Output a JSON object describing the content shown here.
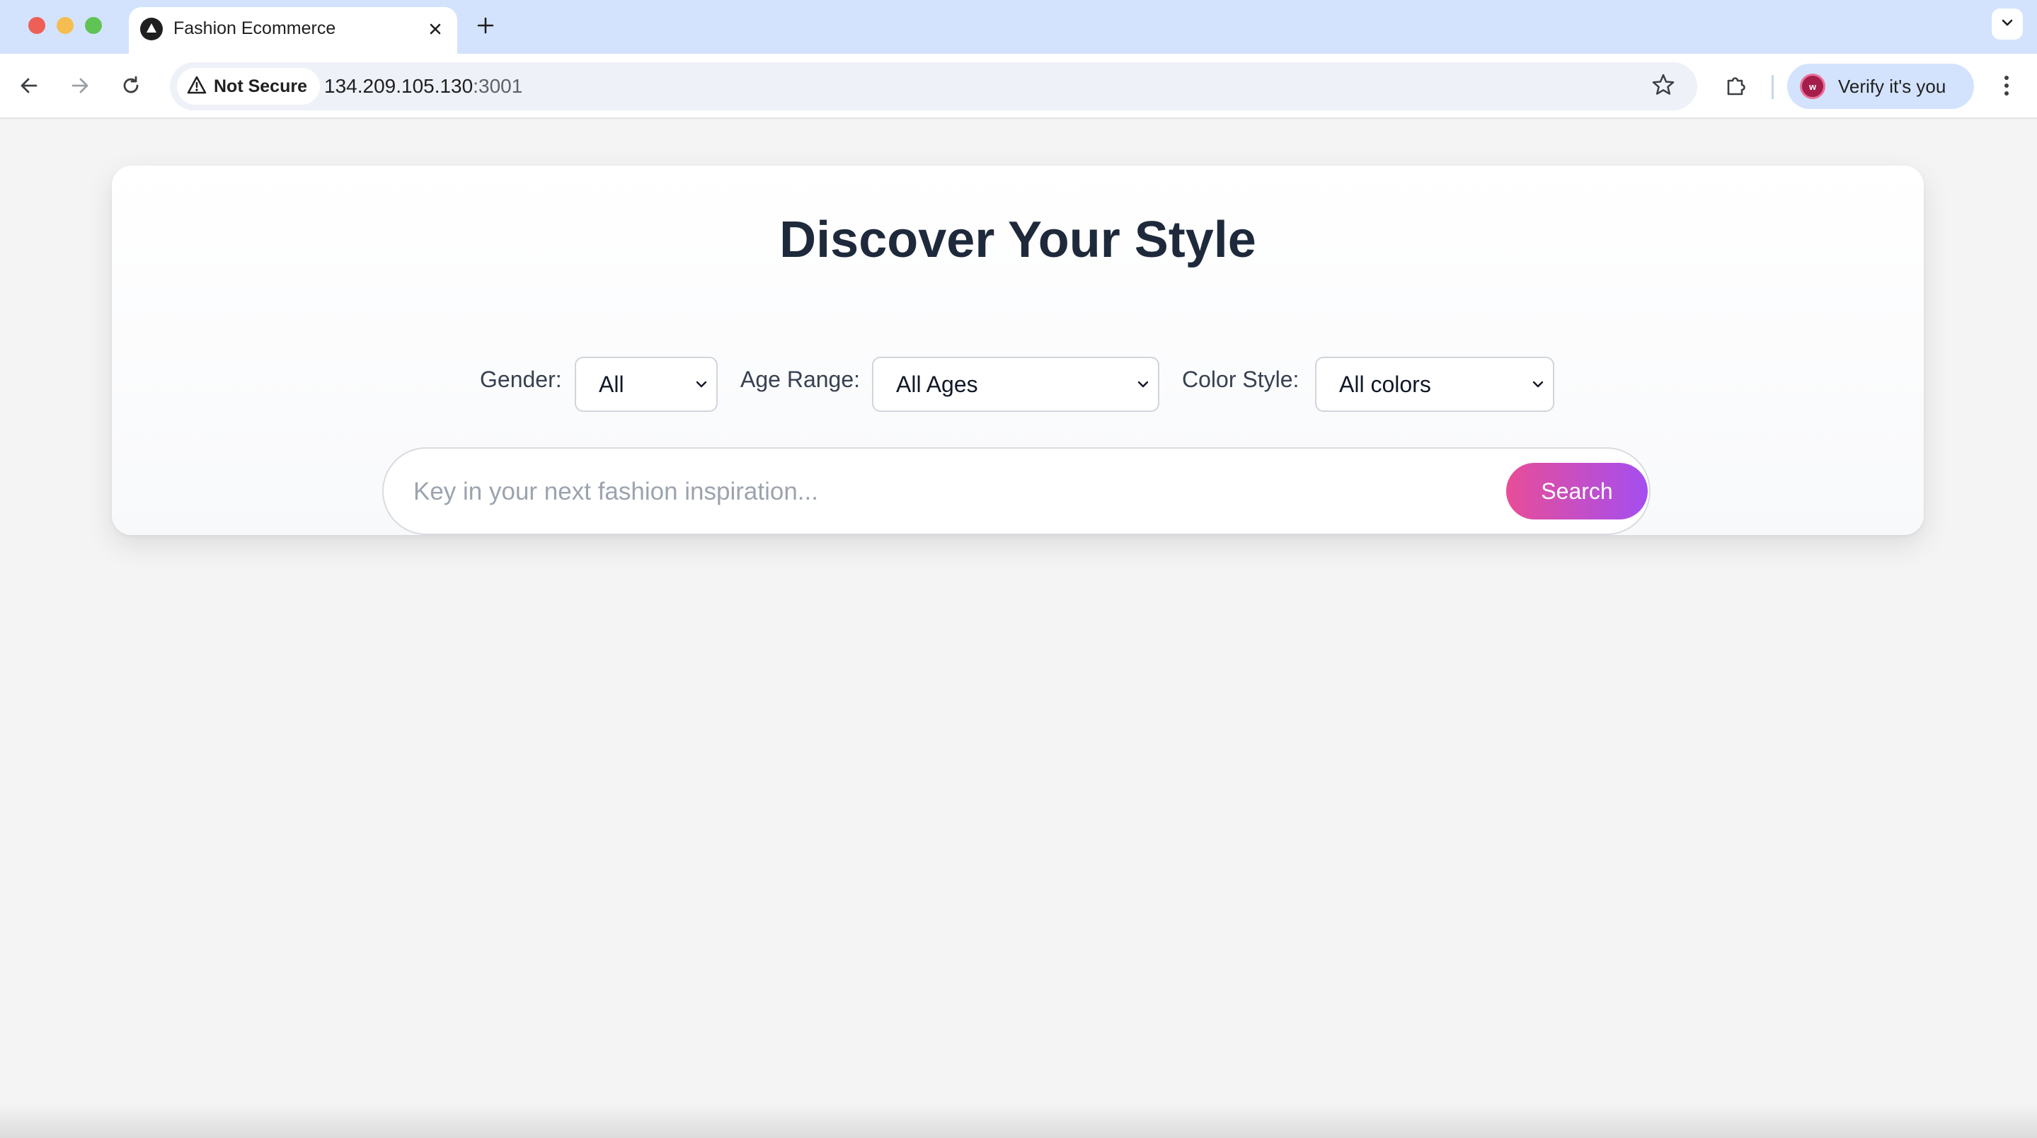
{
  "browser": {
    "tab": {
      "title": "Fashion Ecommerce"
    },
    "address_bar": {
      "security_label": "Not Secure",
      "host": "134.209.105.130",
      "port": ":3001"
    },
    "profile": {
      "avatar_letter": "w",
      "label": "Verify it's you"
    }
  },
  "page": {
    "headline": "Discover Your Style",
    "filters": {
      "gender": {
        "label": "Gender:",
        "value": "All"
      },
      "age_range": {
        "label": "Age Range:",
        "value": "All Ages"
      },
      "color_style": {
        "label": "Color Style:",
        "value": "All colors"
      }
    },
    "search": {
      "placeholder": "Key in your next fashion inspiration...",
      "value": "",
      "button_label": "Search"
    }
  },
  "colors": {
    "tabstrip_bg": "#d3e3fd",
    "page_bg": "#f4f4f4",
    "headline": "#1e2a3b",
    "search_gradient_start": "#e84d97",
    "search_gradient_end": "#a44ef0"
  },
  "icons": {
    "tab_favicon": "triangle-logo-icon",
    "close": "close-icon",
    "new_tab": "plus-icon",
    "tab_search": "chevron-down-icon",
    "back": "back-arrow-icon",
    "forward": "forward-arrow-icon",
    "reload": "reload-icon",
    "warning": "warning-icon",
    "bookmark": "star-icon",
    "extensions": "puzzle-icon",
    "menu": "kebab-menu-icon"
  }
}
